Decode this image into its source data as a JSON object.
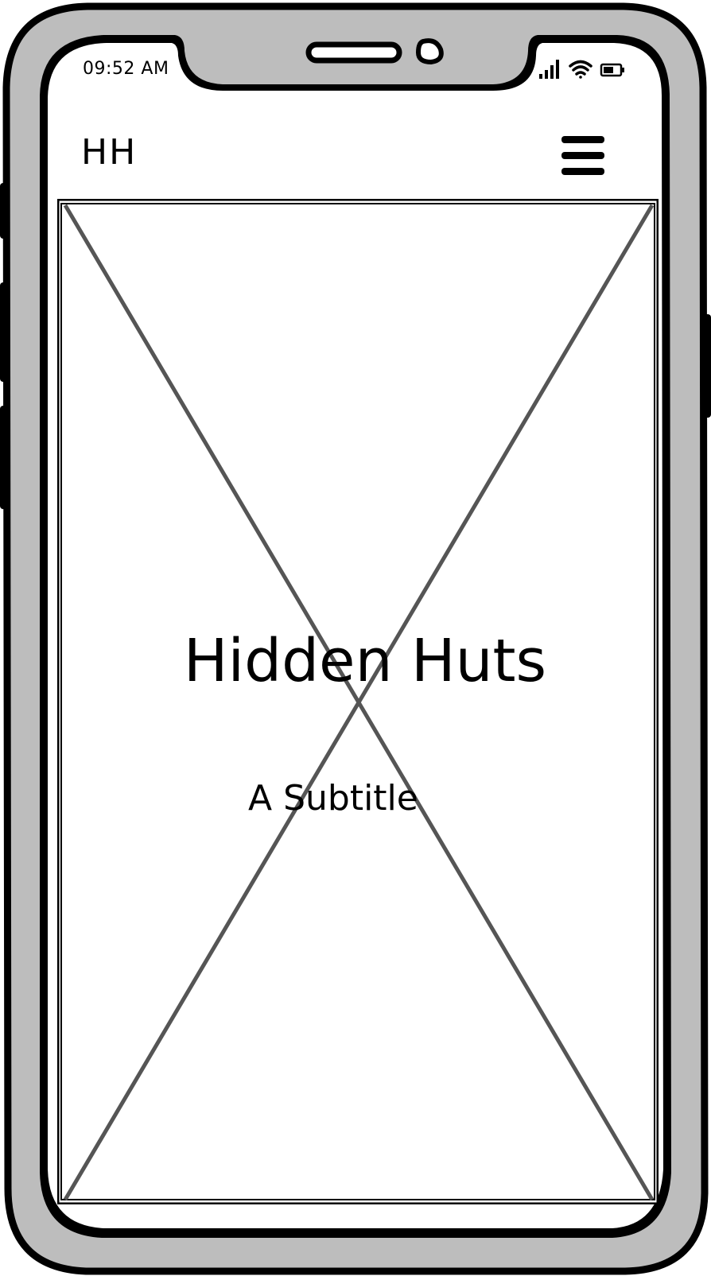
{
  "status_bar": {
    "time": "09:52 AM",
    "icons": [
      "cellular-signal-icon",
      "wifi-icon",
      "battery-icon"
    ]
  },
  "header": {
    "logo": "HH",
    "menu_icon": "hamburger-menu-icon"
  },
  "hero": {
    "image_placeholder": "image-placeholder-x",
    "title": "Hidden Huts",
    "subtitle": "A Subtitle"
  },
  "colors": {
    "device_body": "#bdbdbd",
    "outline": "#000000",
    "placeholder_lines": "#555555",
    "screen": "#ffffff"
  }
}
